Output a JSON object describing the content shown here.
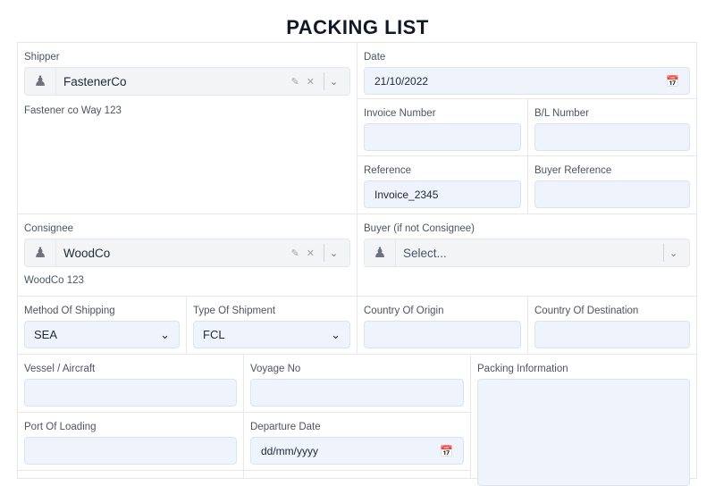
{
  "title": "PACKING LIST",
  "shipper": {
    "label": "Shipper",
    "value": "FastenerCo",
    "address": "Fastener co Way 123"
  },
  "date": {
    "label": "Date",
    "value": "21/10/2022"
  },
  "invoice_number": {
    "label": "Invoice Number",
    "value": ""
  },
  "bl_number": {
    "label": "B/L Number",
    "value": ""
  },
  "reference": {
    "label": "Reference",
    "value": "Invoice_2345"
  },
  "buyer_reference": {
    "label": "Buyer Reference",
    "value": ""
  },
  "consignee": {
    "label": "Consignee",
    "value": "WoodCo",
    "address": "WoodCo 123"
  },
  "buyer": {
    "label": "Buyer (if not Consignee)",
    "placeholder": "Select..."
  },
  "method_of_shipping": {
    "label": "Method Of Shipping",
    "value": "SEA"
  },
  "type_of_shipment": {
    "label": "Type Of Shipment",
    "value": "FCL"
  },
  "country_of_origin": {
    "label": "Country Of Origin",
    "value": ""
  },
  "country_of_destination": {
    "label": "Country Of Destination",
    "value": ""
  },
  "vessel": {
    "label": "Vessel / Aircraft",
    "value": ""
  },
  "voyage_no": {
    "label": "Voyage No",
    "value": ""
  },
  "packing_information": {
    "label": "Packing Information",
    "value": ""
  },
  "port_of_loading": {
    "label": "Port Of Loading",
    "value": ""
  },
  "departure_date": {
    "label": "Departure Date",
    "placeholder": "dd/mm/yyyy"
  }
}
